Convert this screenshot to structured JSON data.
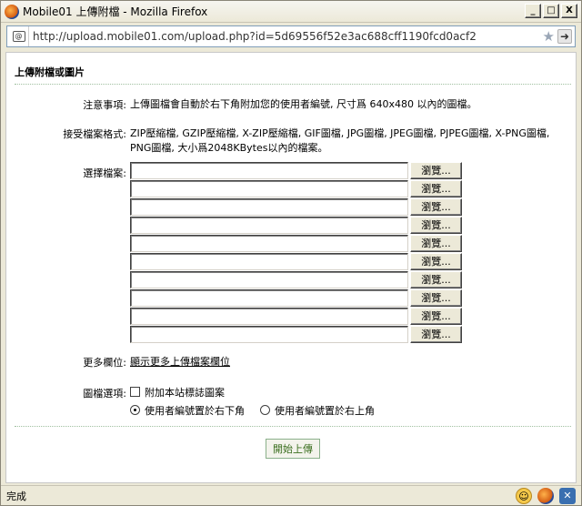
{
  "window": {
    "title": "Mobile01 上傳附檔 - Mozilla Firefox",
    "minimize": "_",
    "maximize": "□",
    "close": "X"
  },
  "urlbar": {
    "url": "http://upload.mobile01.com/upload.php?id=5d69556f52e3ac688cff1190fcd0acf2"
  },
  "page": {
    "title": "上傳附檔或圖片",
    "notice_label": "注意事項:",
    "notice_text": "上傳圖檔會自動於右下角附加您的使用者編號, 尺寸爲 640x480 以內的圖檔。",
    "formats_label": "接受檔案格式:",
    "formats_text": "ZIP壓縮檔, GZIP壓縮檔, X-ZIP壓縮檔, GIF圖檔, JPG圖檔, JPEG圖檔, PJPEG圖檔, X-PNG圖檔, PNG圖檔, 大小爲2048KBytes以內的檔案。",
    "choose_label": "選擇檔案:",
    "browse_label": "瀏覽...",
    "file_rows": [
      1,
      2,
      3,
      4,
      5,
      6,
      7,
      8,
      9,
      10
    ],
    "more_label": "更多欄位:",
    "more_link": "顯示更多上傳檔案欄位",
    "image_options_label": "圖檔選項:",
    "watermark_label": "附加本站標誌圖案",
    "watermark_checked": false,
    "position_bottom_right": "使用者編號置於右下角",
    "position_top_right": "使用者編號置於右上角",
    "position_selected": "bottom_right",
    "submit_label": "開始上傳"
  },
  "statusbar": {
    "text": "完成"
  }
}
